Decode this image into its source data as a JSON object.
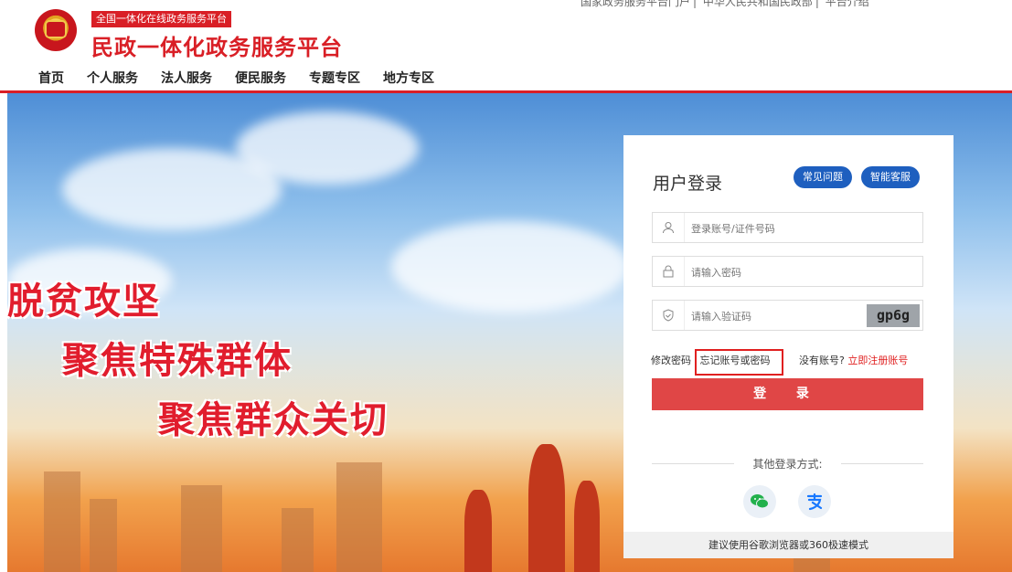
{
  "top_links": [
    "国家政务服务平台门户",
    "中华人民共和国民政部",
    "平台介绍"
  ],
  "header": {
    "tagline": "全国一体化在线政务服务平台",
    "title": "民政一体化政务服务平台"
  },
  "nav": [
    "首页",
    "个人服务",
    "法人服务",
    "便民服务",
    "专题专区",
    "地方专区"
  ],
  "hero": {
    "slogan1": "脱贫攻坚",
    "slogan2": "聚焦特殊群体",
    "slogan3": "聚焦群众关切"
  },
  "login": {
    "title": "用户登录",
    "faq_label": "常见问题",
    "service_label": "智能客服",
    "account_placeholder": "登录账号/证件号码",
    "password_placeholder": "请输入密码",
    "captcha_placeholder": "请输入验证码",
    "captcha_text": "gp6g",
    "change_password": "修改密码",
    "forgot": "忘记账号或密码",
    "no_account": "没有账号?",
    "register": "立即注册账号",
    "submit": "登 录",
    "other_methods": "其他登录方式:",
    "footer_note": "建议使用谷歌浏览器或360极速模式"
  }
}
